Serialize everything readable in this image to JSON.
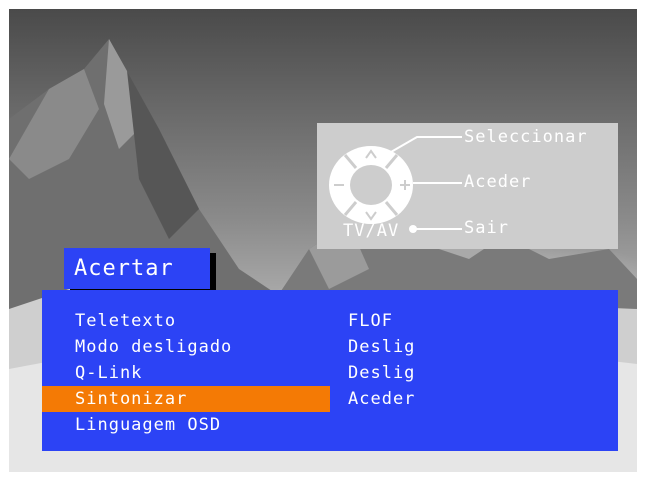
{
  "help": {
    "select_label": "Seleccionar",
    "enter_label": "Aceder",
    "exit_label": "Sair",
    "tvav_label": "TV/AV",
    "icons": [
      "up-arrow-icon",
      "down-arrow-icon",
      "minus-icon",
      "plus-icon"
    ]
  },
  "menu": {
    "title": "Acertar",
    "selected_index": 3,
    "items": [
      {
        "label": "Teletexto",
        "value": "FLOF"
      },
      {
        "label": "Modo desligado",
        "value": "Deslig"
      },
      {
        "label": "Q-Link",
        "value": "Deslig"
      },
      {
        "label": "Sintonizar",
        "value": "Aceder"
      },
      {
        "label": "Linguagem OSD",
        "value": ""
      }
    ]
  },
  "colors": {
    "menu_blue": "#2c43f5",
    "highlight_orange": "#f47a05",
    "help_panel_gray": "#cdcdcd"
  }
}
